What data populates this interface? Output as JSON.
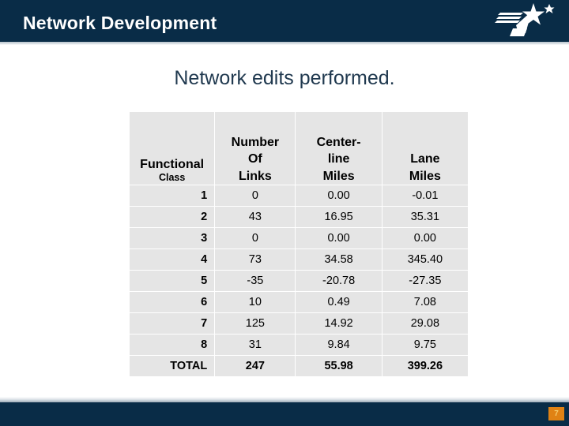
{
  "header": {
    "title": "Network Development",
    "bar_color": "#092c47",
    "logo_name": "star-swoosh-logo"
  },
  "slide": {
    "title": "Network edits performed.",
    "title_color": "#20394f"
  },
  "table": {
    "headers": {
      "functional_class_main": "Functional",
      "functional_class_sub": "Class",
      "number_of_links": [
        "Number",
        "Of",
        "Links"
      ],
      "centerline_miles": [
        "Center-",
        "line",
        "Miles"
      ],
      "lane_miles": [
        "Lane",
        "Miles"
      ]
    },
    "rows": [
      {
        "label": "1",
        "links": "0",
        "centerline": "0.00",
        "lane": "-0.01"
      },
      {
        "label": "2",
        "links": "43",
        "centerline": "16.95",
        "lane": "35.31"
      },
      {
        "label": "3",
        "links": "0",
        "centerline": "0.00",
        "lane": "0.00"
      },
      {
        "label": "4",
        "links": "73",
        "centerline": "34.58",
        "lane": "345.40"
      },
      {
        "label": "5",
        "links": "-35",
        "centerline": "-20.78",
        "lane": "-27.35"
      },
      {
        "label": "6",
        "links": "10",
        "centerline": "0.49",
        "lane": "7.08"
      },
      {
        "label": "7",
        "links": "125",
        "centerline": "14.92",
        "lane": "29.08"
      },
      {
        "label": "8",
        "links": "31",
        "centerline": "9.84",
        "lane": "9.75"
      }
    ],
    "total_row": {
      "label": "TOTAL",
      "links": "247",
      "centerline": "55.98",
      "lane": "399.26"
    },
    "cell_color": "#e5e5e5"
  },
  "footer": {
    "bar_color": "#092c47",
    "page_number": "7",
    "badge_color": "#e08214"
  }
}
